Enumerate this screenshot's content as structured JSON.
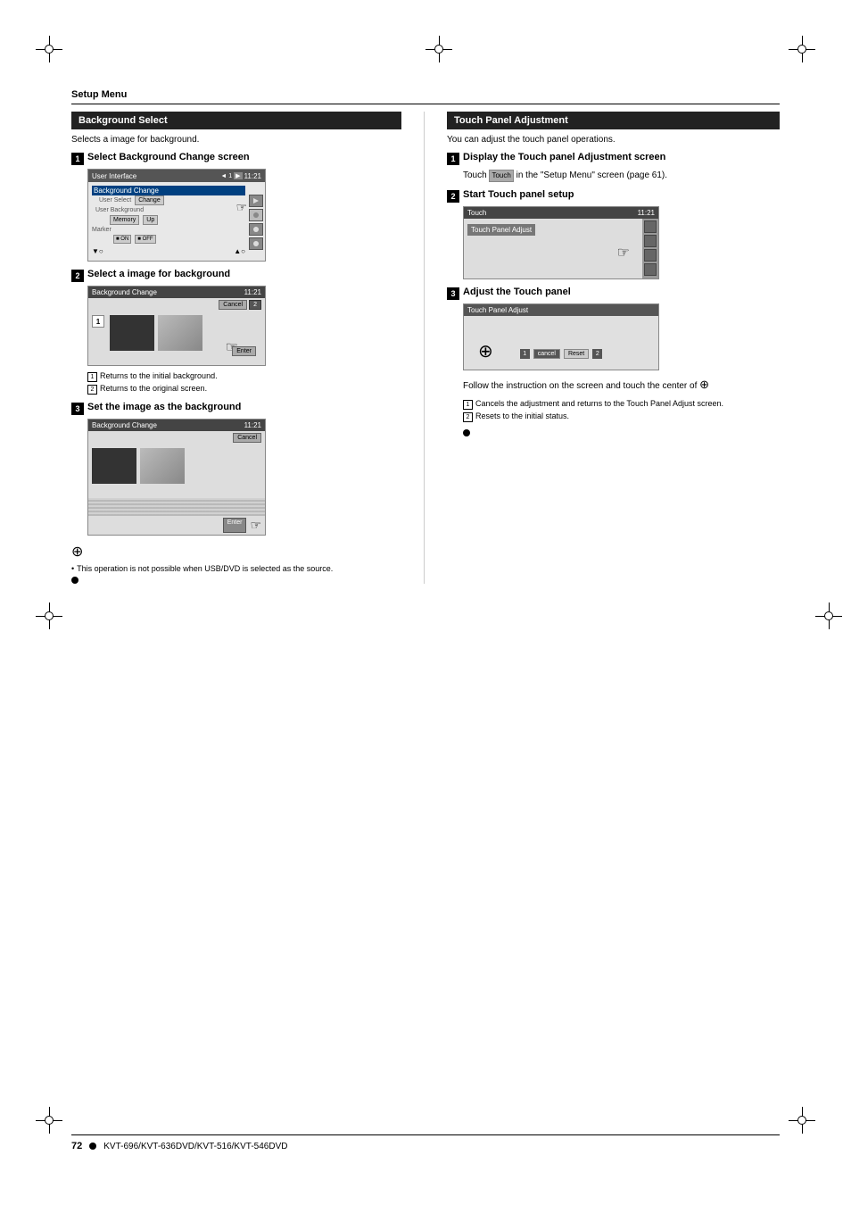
{
  "page": {
    "title": "Setup Menu",
    "footer_page": "72",
    "footer_bullet": "●",
    "footer_model": "KVT-696/KVT-636DVD/KVT-516/KVT-546DVD"
  },
  "left_panel": {
    "title": "Background Select",
    "desc": "Selects a image for background.",
    "steps": [
      {
        "num": "1",
        "title": "Select Background Change screen",
        "screen1_title": "User Interface",
        "screen1_time": "11:21",
        "menu_items": [
          "Background Change",
          "User Select",
          "User Background",
          "Memory",
          "Marker"
        ]
      },
      {
        "num": "2",
        "title": "Select a image for background",
        "screen2_title": "Background Change",
        "screen2_time": "11:21",
        "cancel_btn": "Cancel",
        "enter_btn": "Enter",
        "note1": "Returns to the initial background.",
        "note2": "Returns to the original screen."
      },
      {
        "num": "3",
        "title": "Set the image as the background",
        "screen3_title": "Background Change",
        "screen3_time": "11:21",
        "cancel_btn": "Cancel",
        "enter_btn": "Enter"
      }
    ],
    "warning_note": "This operation is not possible when USB/DVD is selected as the source."
  },
  "right_panel": {
    "title": "Touch Panel Adjustment",
    "desc": "You can adjust the touch panel operations.",
    "steps": [
      {
        "num": "1",
        "title": "Display the Touch panel Adjustment screen",
        "text1": "Touch",
        "touch_label": "Touch",
        "text2": "in the \"Setup Menu\" screen (page 61)."
      },
      {
        "num": "2",
        "title": "Start Touch panel setup",
        "screen_title": "Touch",
        "submenu": "Touch Panel Adjust",
        "time": "11:21"
      },
      {
        "num": "3",
        "title": "Adjust the Touch panel",
        "adjust_screen_title": "Touch Panel Adjust",
        "btn1": "cancel",
        "btn2": "Reset",
        "follow_text": "Follow the instruction on the screen and touch the center of",
        "note1": "Cancels the adjustment and returns to the Touch Panel Adjust screen.",
        "note2": "Resets to the initial status."
      }
    ]
  }
}
